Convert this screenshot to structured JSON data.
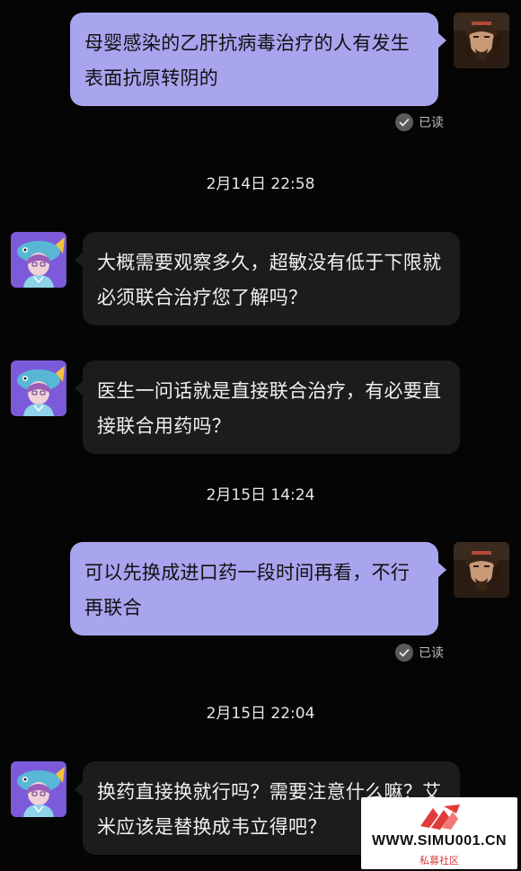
{
  "messages": [
    {
      "from": "me",
      "text": "母婴感染的乙肝抗病毒治疗的人有发生表面抗原转阴的",
      "read_label": "已读"
    },
    {
      "from": "other",
      "text": "大概需要观察多久，超敏没有低于下限就必须联合治疗您了解吗？"
    },
    {
      "from": "other",
      "text": "医生一问话就是直接联合治疗，有必要直接联合用药吗？"
    },
    {
      "from": "me",
      "text": "可以先换成进口药一段时间再看，不行再联合",
      "read_label": "已读"
    },
    {
      "from": "other",
      "text": "换药直接换就行吗？需要注意什么嘛？艾米应该是替换成韦立得吧？"
    }
  ],
  "timestamps": [
    "2月14日 22:58",
    "2月15日 14:24",
    "2月15日 22:04"
  ],
  "watermark": {
    "site": "WWW.SIMU001.CN",
    "subtitle": "私募社区"
  },
  "colors": {
    "outgoing_bubble": "#a8a4ee",
    "incoming_bubble": "#1c1c1e",
    "background": "#050505"
  }
}
